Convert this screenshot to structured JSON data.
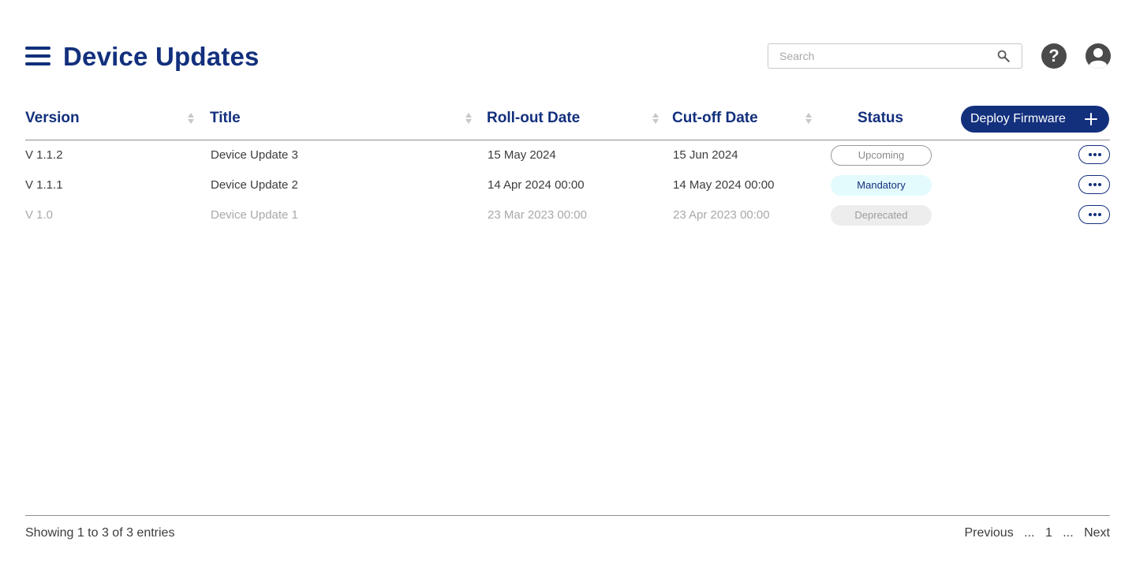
{
  "header": {
    "title": "Device Updates",
    "search_placeholder": "Search",
    "help_glyph": "?",
    "icons": [
      "menu-icon",
      "search-icon",
      "help-icon",
      "profile-icon"
    ]
  },
  "table": {
    "columns": {
      "version": "Version",
      "title": "Title",
      "rollout": "Roll-out Date",
      "cutoff": "Cut-off Date",
      "status": "Status"
    },
    "deploy_label": "Deploy Firmware",
    "rows": [
      {
        "version": "V 1.1.2",
        "title": "Device Update 3",
        "rollout": "15 May 2024",
        "cutoff": "15 Jun 2024",
        "status": "Upcoming"
      },
      {
        "version": "V 1.1.1",
        "title": "Device Update 2",
        "rollout": "14 Apr 2024 00:00",
        "cutoff": "14 May 2024 00:00",
        "status": "Mandatory"
      },
      {
        "version": "V 1.0",
        "title": "Device Update 1",
        "rollout": "23 Mar 2023 00:00",
        "cutoff": "23 Apr 2023 00:00",
        "status": "Deprecated"
      }
    ]
  },
  "footer": {
    "entries_text": "Showing 1 to 3 of 3 entries",
    "previous": "Previous",
    "ellipsis": "...",
    "page": "1",
    "next": "Next"
  },
  "colors": {
    "brand": "#13307d",
    "mandatory_bg": "#e3fbfd",
    "deprecated_bg": "#ededed",
    "icon_dark": "#4a4a4a"
  }
}
